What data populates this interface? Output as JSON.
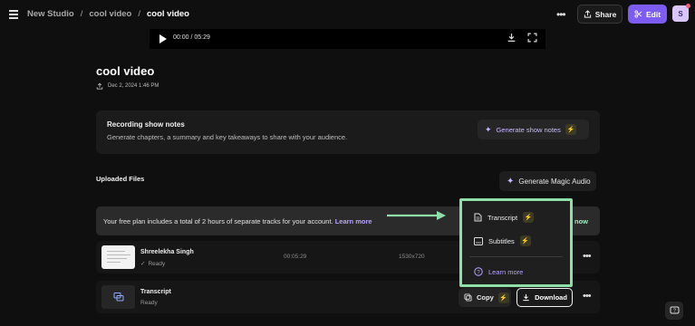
{
  "breadcrumb": {
    "studio": "New Studio",
    "folder": "cool video",
    "current": "cool video",
    "separator": "/"
  },
  "header": {
    "more_label": "•••",
    "share_label": "Share",
    "edit_label": "Edit",
    "avatar_initial": "S"
  },
  "player": {
    "time": "00:00 / 05:29"
  },
  "page": {
    "title": "cool video",
    "date": "Dec 2, 2024 1:46 PM"
  },
  "show_notes": {
    "title": "Recording show notes",
    "description": "Generate chapters, a summary and key takeaways to share with your audience.",
    "button_label": "Generate show notes"
  },
  "uploaded": {
    "label": "Uploaded Files",
    "magic_button": "Generate Magic Audio"
  },
  "banner": {
    "text": "Your free plan includes a total of 2 hours of separate tracks for your account.",
    "link": "Learn more",
    "cta_tail": "now"
  },
  "files": [
    {
      "title": "Shreelekha Singh",
      "status": "Ready",
      "duration": "00:05:29",
      "resolution": "1530x720",
      "more": "•••"
    },
    {
      "title": "Transcript",
      "status": "Ready",
      "copy_label": "Copy",
      "download_label": "Download",
      "more": "•••"
    }
  ],
  "menu": {
    "items": [
      {
        "label": "Transcript"
      },
      {
        "label": "Subtitles"
      }
    ],
    "learn_more": "Learn more"
  },
  "colors": {
    "accent": "#7c5cf2",
    "highlight": "#8fe0a8",
    "link": "#b7a4ff"
  }
}
